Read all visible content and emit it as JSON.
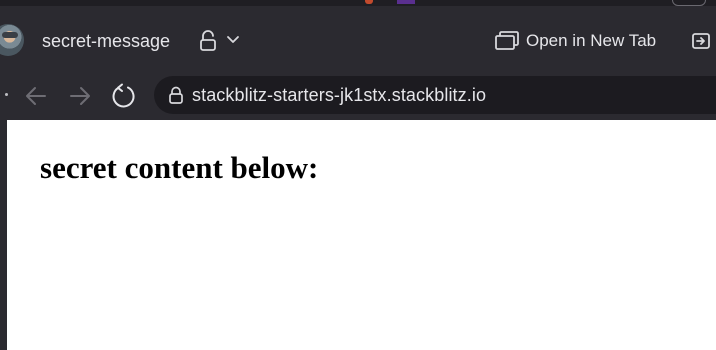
{
  "browser": {
    "tab": {
      "title": "secret-message"
    },
    "open_in_new_tab_label": "Open in New Tab",
    "address_bar": {
      "url": "stackblitz-starters-jk1stx.stackblitz.io"
    },
    "icons": {
      "lock": "lock-icon",
      "open_lock": "unlocked-icon",
      "chevron": "chevron-down-icon",
      "back": "back-arrow-icon",
      "forward": "forward-arrow-icon",
      "reload": "reload-icon",
      "new_tab": "open-in-new-tab-icon",
      "exit": "exit-icon"
    },
    "colors": {
      "chrome_background": "#2b2a30",
      "address_bar_background": "#1c1b20",
      "text": "#e6e6ea",
      "page_background": "#ffffff"
    }
  },
  "page": {
    "heading": "secret content below:"
  }
}
